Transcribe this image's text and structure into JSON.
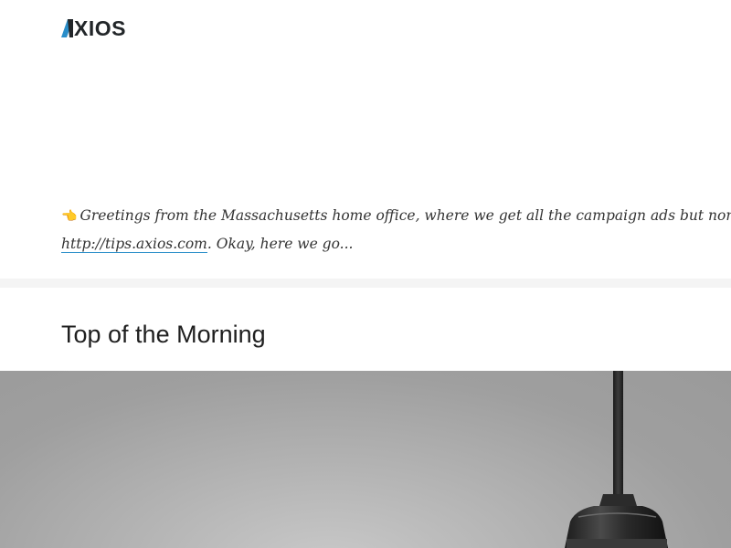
{
  "header": {
    "logo_text": "XIOS",
    "logo_alt": "AXIOS",
    "logo_accent_color": "#2a8ec9"
  },
  "intro": {
    "emoji_icon": "pointing-hand-icon",
    "emoji_glyph": "👈",
    "text_line1": "Greetings from the Massachusetts home office, where we get all the campaign ads but none of",
    "link_text": "http://tips.axios.com",
    "text_line2_rest": ". Okay, here we go..."
  },
  "section": {
    "title": "Top of the Morning"
  },
  "hero_image": {
    "subject": "pendant-lamp-image"
  }
}
